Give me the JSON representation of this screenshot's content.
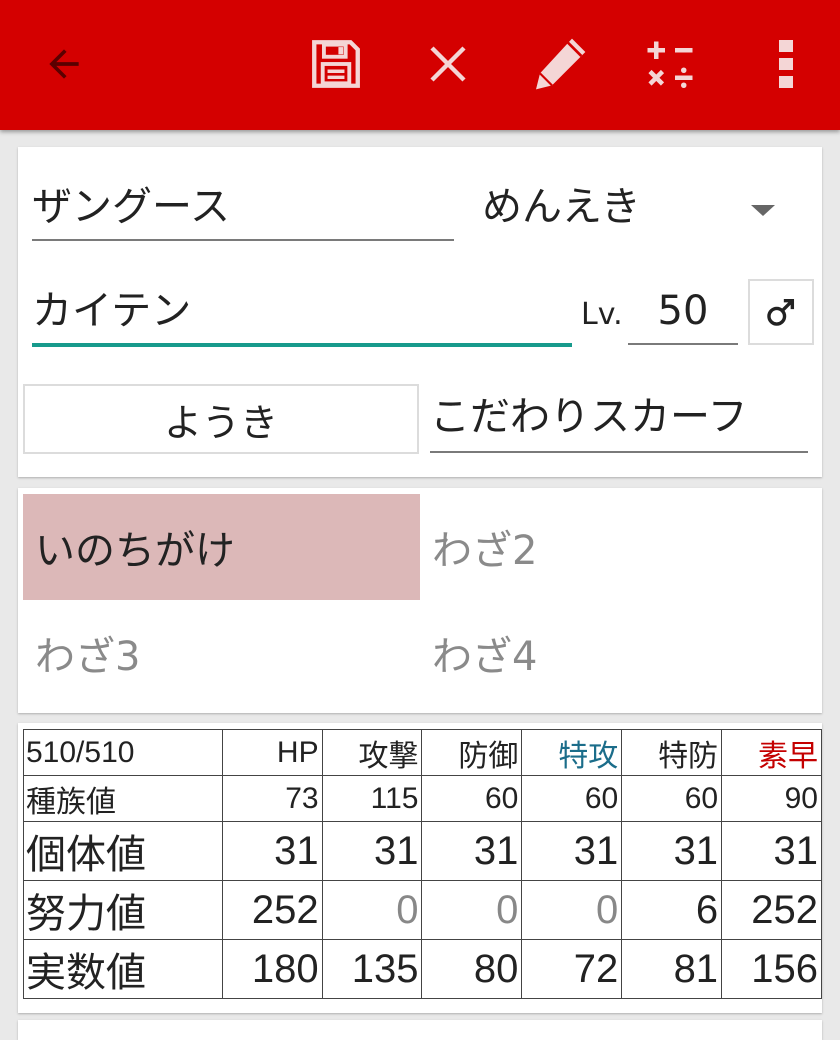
{
  "colors": {
    "appbar": "#d40000",
    "selected_move": "#dcb8b8",
    "focus_underline": "#179a8c",
    "sp_atk_header": "#1b6d8a",
    "speed_header": "#c40000"
  },
  "toolbar": {
    "icons": [
      "arrow-left-icon",
      "save-icon",
      "close-icon",
      "pencil-icon",
      "calculator-icon",
      "more-vert-icon"
    ]
  },
  "form": {
    "species": "ザングース",
    "ability": "めんえき",
    "nickname": "カイテン",
    "level_label": "Lv.",
    "level": "50",
    "gender_symbol": "♂",
    "nature": "ようき",
    "item": "こだわりスカーフ"
  },
  "moves": [
    {
      "label": "いのちがけ",
      "selected": true
    },
    {
      "label": "わざ2",
      "selected": false
    },
    {
      "label": "わざ3",
      "selected": false
    },
    {
      "label": "わざ4",
      "selected": false
    }
  ],
  "stats": {
    "total": "510/510",
    "headers": [
      "HP",
      "攻撃",
      "防御",
      "特攻",
      "特防",
      "素早"
    ],
    "rows": [
      {
        "label": "種族値",
        "values": [
          "73",
          "115",
          "60",
          "60",
          "60",
          "90"
        ]
      },
      {
        "label": "個体値",
        "values": [
          "31",
          "31",
          "31",
          "31",
          "31",
          "31"
        ]
      },
      {
        "label": "努力値",
        "values": [
          "252",
          "0",
          "0",
          "0",
          "6",
          "252"
        ]
      },
      {
        "label": "実数値",
        "values": [
          "180",
          "135",
          "80",
          "72",
          "81",
          "156"
        ]
      }
    ]
  }
}
